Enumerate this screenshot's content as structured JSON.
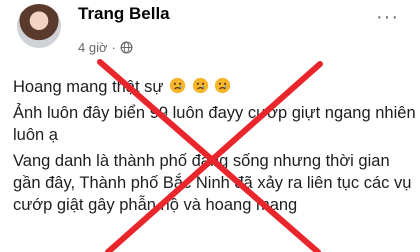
{
  "post": {
    "author": "Trang Bella",
    "time": "4 giờ",
    "separator": "·",
    "more_label": "···",
    "lines": [
      "Hoang mang thật sự",
      "Ảnh luôn đây biển 99 luôn đayy cướp giựt ngang nhiên luôn ạ",
      "Vang danh là thành phố đáng sống nhưng thời gian gần đây, Thành phố Bắc Ninh đã xảy ra liên tục các vụ cướp giật gây phẫn nộ và hoang mang"
    ],
    "emojis": [
      "crying-face-icon",
      "crying-face-icon",
      "crying-face-icon"
    ]
  },
  "overlay": {
    "x_color": "#e8262b"
  }
}
